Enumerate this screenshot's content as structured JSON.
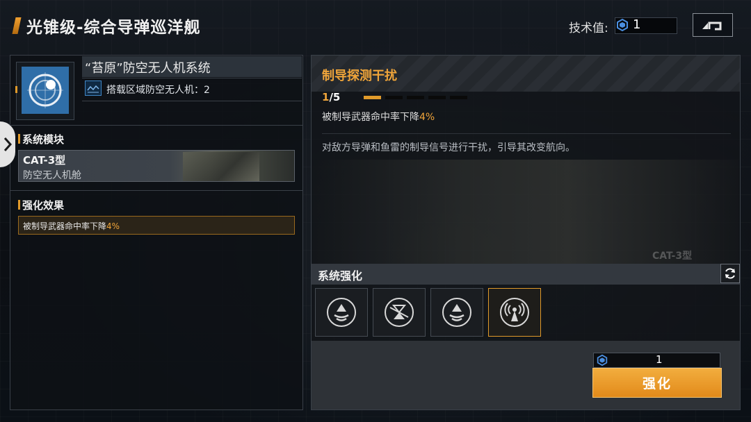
{
  "header": {
    "title": "光锥级-综合导弹巡洋舰",
    "tech_label": "技术值:",
    "tech_value": "1"
  },
  "left_panel": {
    "system_name": "“苔原”防空无人机系统",
    "drone_info": "搭载区域防空无人机：2",
    "module_section_title": "系统模块",
    "module_name": "CAT-3型",
    "module_subtitle": "防空无人机舱",
    "effect_section_title": "强化效果",
    "effect_prefix": "被制导武器命中率下降",
    "effect_value": "4%"
  },
  "right_panel": {
    "skill_name": "制导探测干扰",
    "level_current": "1",
    "level_max": "/5",
    "level_progress": 1,
    "level_total": 5,
    "effect_prefix": "被制导武器命中率下降",
    "effect_value": "4%",
    "description": "对敌方导弹和鱼雷的制导信号进行干扰，引导其改变航向。",
    "ship_tag": "CAT-3型",
    "enhance_section_title": "系统强化",
    "slots": [
      {
        "icon": "interceptor-icon",
        "selected": false
      },
      {
        "icon": "jammer-icon",
        "selected": false
      },
      {
        "icon": "interceptor-icon",
        "selected": false
      },
      {
        "icon": "signal-tower-icon",
        "selected": true
      }
    ],
    "cost_value": "1",
    "enhance_button": "强化"
  },
  "colors": {
    "accent": "#e09a2a",
    "highlight": "#f0a53a",
    "icon_blue": "#2f6ea8"
  }
}
